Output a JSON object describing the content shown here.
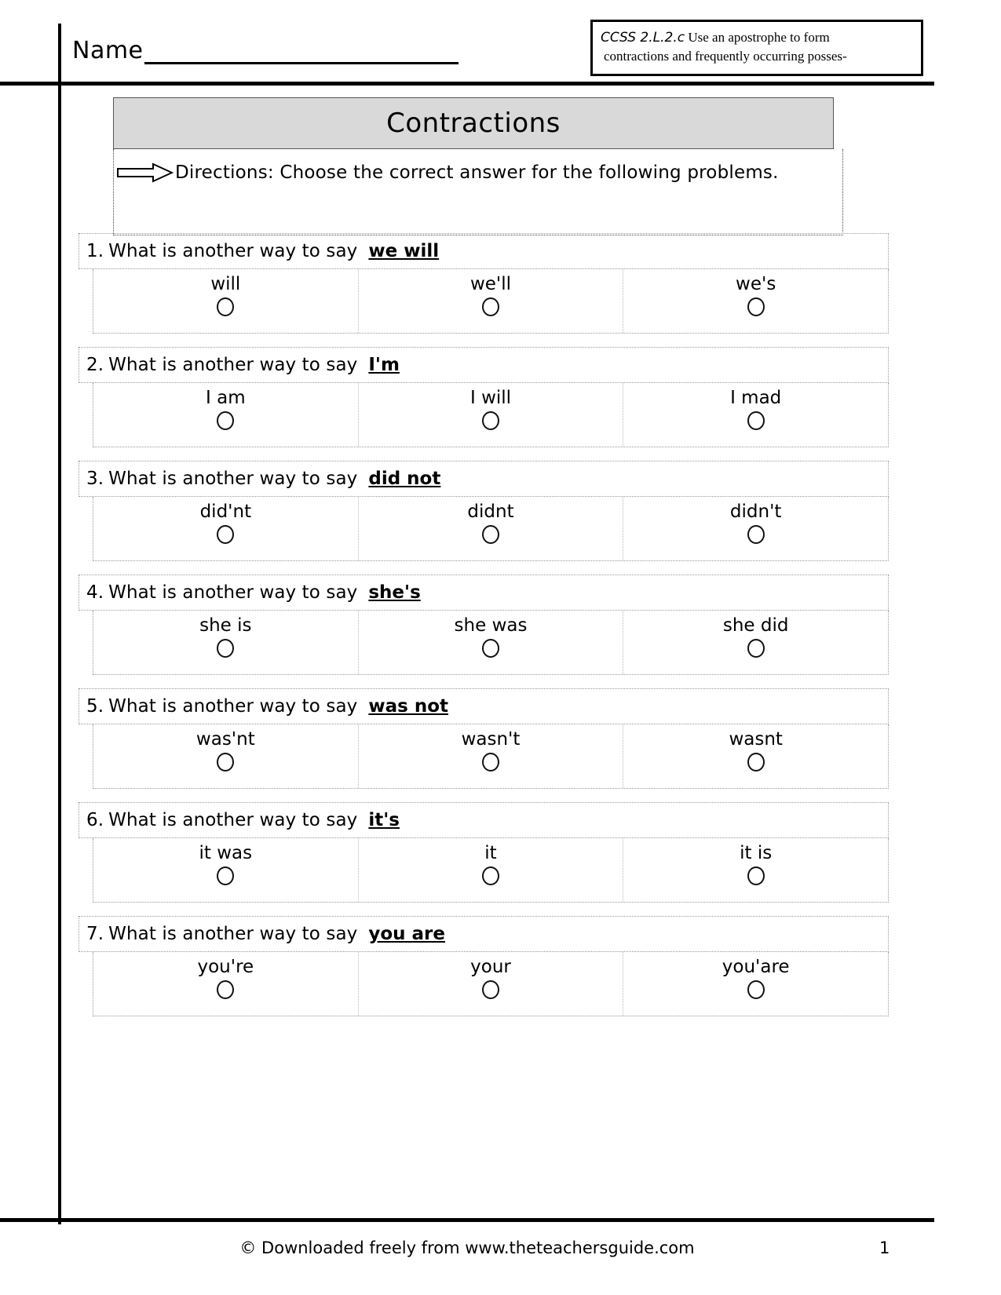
{
  "header": {
    "name_label": "Name",
    "name_value": "",
    "ccss_code": "CCSS 2.L.2.c",
    "ccss_text_line1": "Use an apostrophe to form",
    "ccss_text_line2": "contractions and frequently occurring posses-"
  },
  "title": "Contractions",
  "directions": {
    "icon": "arrow-right-icon",
    "text": "Directions: Choose the correct answer for the following problems."
  },
  "questions": [
    {
      "number": "1.",
      "stem": "What is another way to say",
      "phrase": "we will",
      "options": [
        "will",
        "we'll",
        "we's"
      ]
    },
    {
      "number": "2.",
      "stem": "What is another way to say",
      "phrase": "I'm",
      "options": [
        "I am",
        "I will",
        "I mad"
      ]
    },
    {
      "number": "3.",
      "stem": "What is another way to say",
      "phrase": "did not",
      "options": [
        "did'nt",
        "didnt",
        "didn't"
      ]
    },
    {
      "number": "4.",
      "stem": "What is another way to say",
      "phrase": "she's",
      "options": [
        "she is",
        "she was",
        "she did"
      ]
    },
    {
      "number": "5.",
      "stem": "What is another way to say",
      "phrase": "was not",
      "options": [
        "was'nt",
        "wasn't",
        "wasnt"
      ]
    },
    {
      "number": "6.",
      "stem": "What is another way to say",
      "phrase": "it's",
      "options": [
        "it was",
        "it",
        "it is"
      ]
    },
    {
      "number": "7.",
      "stem": "What is another way to say",
      "phrase": "you are",
      "options": [
        "you're",
        "your",
        "you'are"
      ]
    }
  ],
  "footer": {
    "credit": "© Downloaded freely from www.theteachersguide.com",
    "page_number": "1"
  },
  "colors": {
    "banner_bg": "#d9d9d9",
    "ink": "#000000",
    "dotted_border": "#999999"
  }
}
